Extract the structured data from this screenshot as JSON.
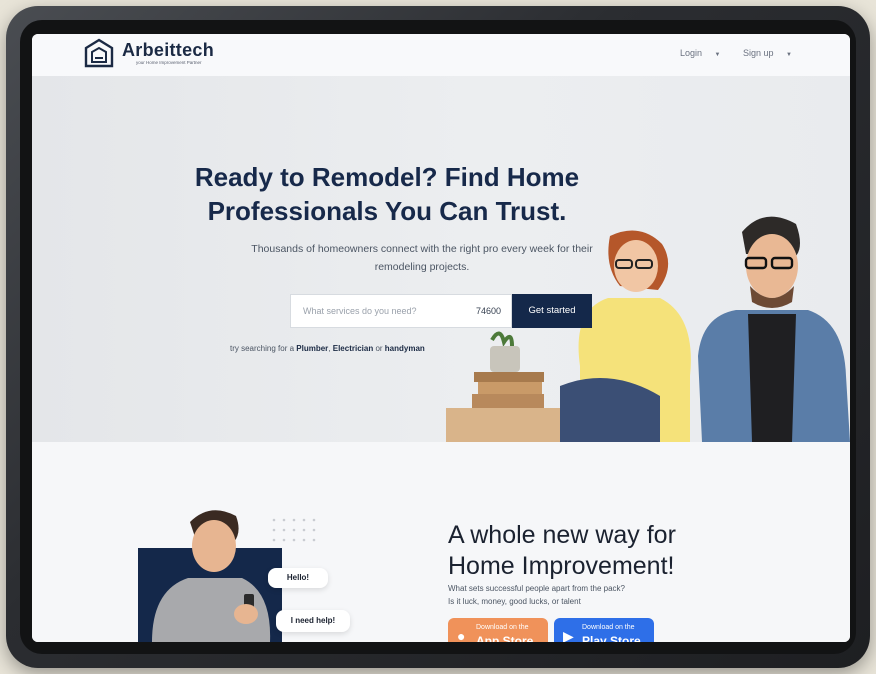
{
  "brand": {
    "name": "Arbeittech",
    "tagline": "your Home Improvement Partner"
  },
  "nav": {
    "login": "Login",
    "signup": "Sign up"
  },
  "hero": {
    "title_line1": "Ready to Remodel? Find Home",
    "title_line2": "Professionals You Can Trust.",
    "subtitle_line1": "Thousands of homeowners connect with the right pro every week for their",
    "subtitle_line2": "remodeling projects.",
    "search_placeholder": "What services do you need?",
    "zip_value": "74600",
    "cta": "Get started",
    "try_prefix": "try searching for a",
    "try_plumber": "Plumber",
    "try_electrician": "Electrician",
    "try_or": "or",
    "try_handyman": "handyman"
  },
  "chat": {
    "hello": "Hello!",
    "need_help": "I need help!"
  },
  "section2": {
    "title_line1": "A whole new way for",
    "title_line2": "Home Improvement!",
    "sub_line1": "What sets successful people apart from the pack?",
    "sub_line2": "Is it luck, money, good lucks, or talent",
    "appstore_small": "Download on the",
    "appstore_big": "App Store",
    "playstore_small": "Download on the",
    "playstore_big": "Play Store"
  },
  "colors": {
    "navy": "#14284a",
    "appstore": "#f0925a",
    "playstore": "#2e6fe8"
  }
}
